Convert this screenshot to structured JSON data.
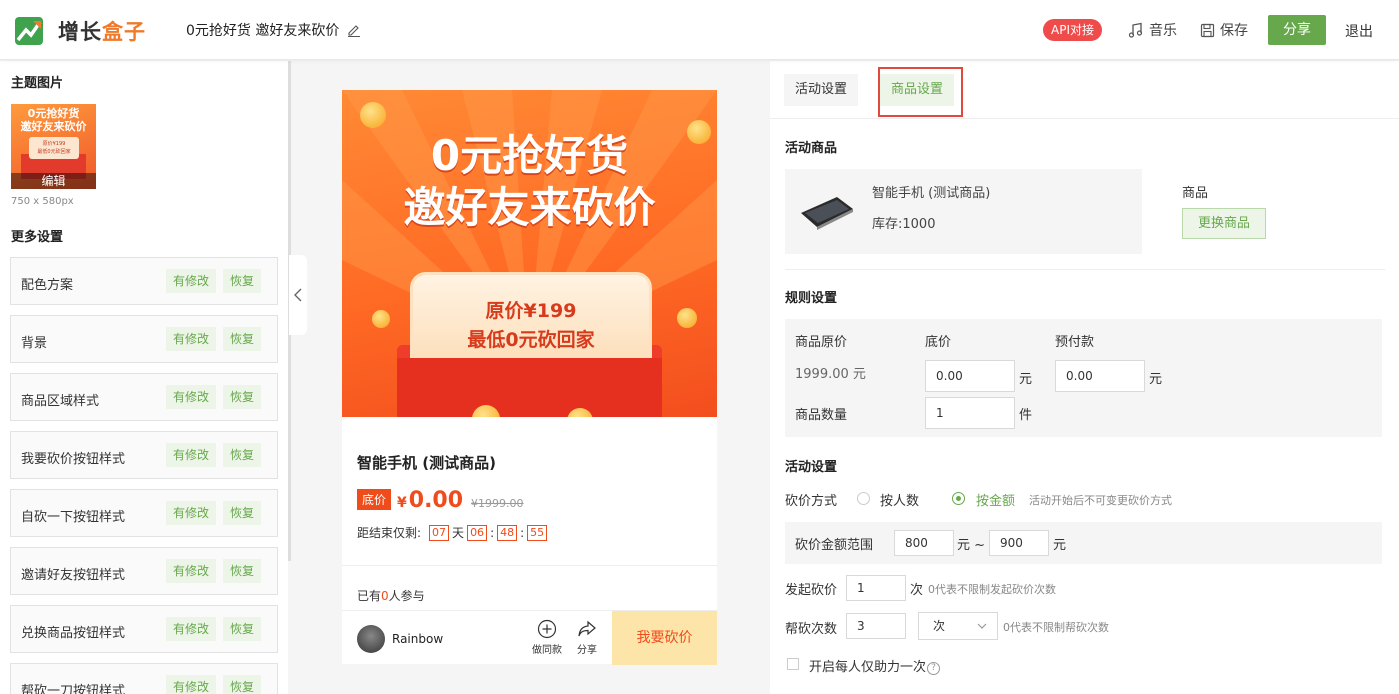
{
  "header": {
    "logo_part1": "增长",
    "logo_part2": "盒子",
    "activity_title": "0元抢好货 邀好友来砍价",
    "api_badge": "API对接",
    "music": "音乐",
    "save": "保存",
    "share": "分享",
    "exit": "退出"
  },
  "left": {
    "theme_image_title": "主题图片",
    "thumb_line1": "0元抢好货",
    "thumb_line2": "邀好友来砍价",
    "thumb_card1": "原价¥199",
    "thumb_card2": "最低0元砍回家",
    "thumb_edit": "编辑",
    "dimension": "750 x 580px",
    "more_settings": "更多设置",
    "modified_label": "有修改",
    "restore_label": "恢复",
    "options": [
      "配色方案",
      "背景",
      "商品区域样式",
      "我要砍价按钮样式",
      "自砍一下按钮样式",
      "邀请好友按钮样式",
      "兑换商品按钮样式",
      "帮砍一刀按钮样式"
    ]
  },
  "preview": {
    "banner_line1": "0元抢好货",
    "banner_line2": "邀好友来砍价",
    "prize_line1": "原价¥199",
    "prize_line2": "最低0元砍回家",
    "product_name": "智能手机 (测试商品)",
    "floor_tag": "底价",
    "yen": "¥",
    "price": "0.00",
    "original_price": "¥1999.00",
    "countdown_prefix": "距结束仅剩:",
    "days": "07",
    "day_unit": "天",
    "hours": "06",
    "colon": ":",
    "minutes": "48",
    "seconds": "55",
    "joined_prefix": "已有",
    "joined_count": "0",
    "joined_suffix": "人参与",
    "username": "Rainbow",
    "same_style": "做同款",
    "share": "分享",
    "cut_button": "我要砍价"
  },
  "right": {
    "tab_activity": "活动设置",
    "tab_goods": "商品设置",
    "activity_goods_title": "活动商品",
    "goods_name": "智能手机 (测试商品)",
    "goods_stock": "库存:1000",
    "goods_label": "商品",
    "change_goods": "更换商品",
    "rules_title": "规则设置",
    "orig_price_label": "商品原价",
    "orig_price_value": "1999.00 元",
    "floor_label": "底价",
    "floor_value": "0.00",
    "prepay_label": "预付款",
    "prepay_value": "0.00",
    "yuan": "元",
    "qty_label": "商品数量",
    "qty_value": "1",
    "qty_unit": "件",
    "act_settings_title": "活动设置",
    "cut_mode_label": "砍价方式",
    "by_people": "按人数",
    "by_amount": "按金额",
    "cut_mode_hint": "活动开始后不可变更砍价方式",
    "range_label": "砍价金额范围",
    "range_min": "800",
    "range_sep": "元 ~",
    "range_max": "900",
    "launch_label": "发起砍价",
    "launch_value": "1",
    "launch_unit": "次",
    "launch_hint": "0代表不限制发起砍价次数",
    "help_label": "帮砍次数",
    "help_value": "3",
    "help_select": "次",
    "help_hint": "0代表不限制帮砍次数",
    "once_label": "开启每人仅助力一次",
    "qm": "?"
  },
  "colors": {
    "accent_green": "#67a84d",
    "accent_orange": "#f04b1b",
    "highlight_red": "#e04a3c"
  }
}
